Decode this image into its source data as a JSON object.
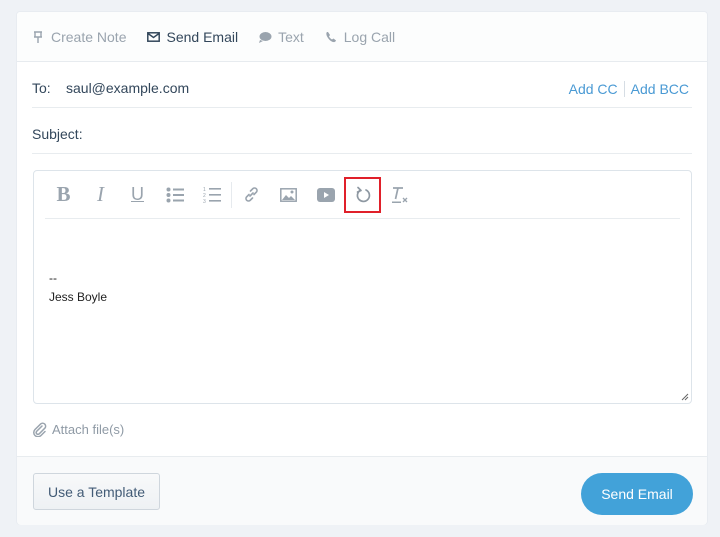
{
  "tabs": [
    {
      "label": "Create Note",
      "icon": "pin-icon",
      "active": false
    },
    {
      "label": "Send Email",
      "icon": "envelope-icon",
      "active": true
    },
    {
      "label": "Text",
      "icon": "chat-bubble-icon",
      "active": false
    },
    {
      "label": "Log Call",
      "icon": "phone-icon",
      "active": false
    }
  ],
  "to": {
    "label": "To:",
    "value": "saul@example.com"
  },
  "cc_links": {
    "add_cc": "Add CC",
    "add_bcc": "Add BCC"
  },
  "subject": {
    "label": "Subject:",
    "value": ""
  },
  "toolbar": {
    "buttons": [
      "bold",
      "italic",
      "underline",
      "bulleted-list",
      "numbered-list",
      "link",
      "image",
      "video",
      "undo",
      "clear-formatting"
    ],
    "highlighted": "undo",
    "highlight_color": "#e0202a"
  },
  "editor": {
    "line1": "--",
    "line2": "Jess Boyle"
  },
  "attach": {
    "label": "Attach file(s)"
  },
  "footer": {
    "template_button": "Use a Template",
    "send_button": "Send Email"
  },
  "colors": {
    "accent": "#42a2d9",
    "link": "#4a9ad4",
    "background": "#eff2f6"
  }
}
